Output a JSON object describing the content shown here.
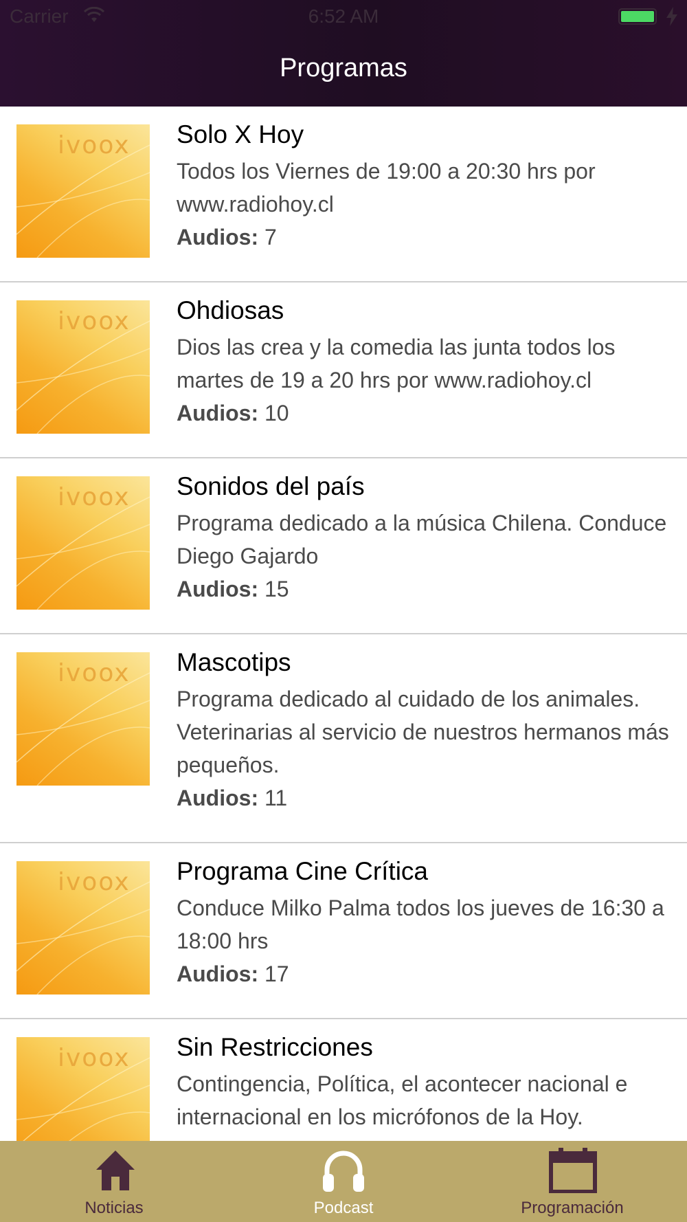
{
  "status_bar": {
    "carrier": "Carrier",
    "time": "6:52 AM"
  },
  "nav": {
    "title": "Programas"
  },
  "programs": [
    {
      "title": "Solo X Hoy",
      "description": "Todos los Viernes de 19:00 a 20:30 hrs por www.radiohoy.cl",
      "audios_label": "Audios:",
      "audios": "7",
      "logo": "ivoox"
    },
    {
      "title": "Ohdiosas",
      "description": "Dios las crea y la comedia las junta todos los martes de 19 a 20 hrs por www.radiohoy.cl",
      "audios_label": "Audios:",
      "audios": "10",
      "logo": "ivoox"
    },
    {
      "title": "Sonidos del país",
      "description": "Programa dedicado a la música Chilena. Conduce Diego Gajardo",
      "audios_label": "Audios:",
      "audios": "15",
      "logo": "ivoox"
    },
    {
      "title": "Mascotips",
      "description": "Programa dedicado al cuidado de los animales. Veterinarias al servicio de nuestros hermanos más pequeños.",
      "audios_label": "Audios:",
      "audios": "11",
      "logo": "ivoox"
    },
    {
      "title": "Programa Cine Crítica",
      "description": "Conduce Milko Palma todos los jueves de 16:30 a 18:00 hrs",
      "audios_label": "Audios:",
      "audios": "17",
      "logo": "ivoox"
    },
    {
      "title": "Sin Restricciones",
      "description": "Contingencia, Política, el acontecer nacional e internacional en los micrófonos de la Hoy.",
      "audios_label": "",
      "audios": "",
      "logo": "ivoox"
    }
  ],
  "tabs": [
    {
      "label": "Noticias",
      "icon": "home-icon",
      "active": false
    },
    {
      "label": "Podcast",
      "icon": "headphones-icon",
      "active": true
    },
    {
      "label": "Programación",
      "icon": "calendar-icon",
      "active": false
    }
  ],
  "colors": {
    "nav_bg": "#230e26",
    "tab_bg": "#bba96b",
    "tab_inactive": "#4a2a3c",
    "tab_active": "#ffffff",
    "battery": "#4cd964"
  }
}
